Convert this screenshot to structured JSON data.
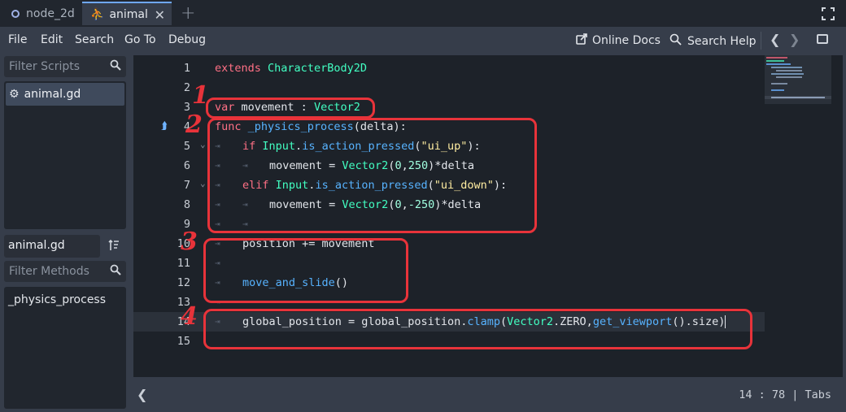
{
  "tabs": [
    {
      "label": "node_2d"
    },
    {
      "label": "animal"
    }
  ],
  "menu": {
    "items": [
      "File",
      "Edit",
      "Search",
      "Go To",
      "Debug"
    ],
    "online_docs": "Online Docs",
    "search_help": "Search Help"
  },
  "scripts_panel": {
    "filter_placeholder": "Filter Scripts",
    "items": [
      "animal.gd"
    ],
    "current_name": "animal.gd"
  },
  "methods_panel": {
    "filter_placeholder": "Filter Methods",
    "items": [
      "_physics_process"
    ]
  },
  "editor": {
    "current_line": 14,
    "lines": [
      {
        "n": "1",
        "code": "extends CharacterBody2D"
      },
      {
        "n": "2",
        "code": ""
      },
      {
        "n": "3",
        "code": "var movement : Vector2"
      },
      {
        "n": "4",
        "code": "func _physics_process(delta):"
      },
      {
        "n": "5",
        "code": "if Input.is_action_pressed(\"ui_up\"):"
      },
      {
        "n": "6",
        "code": "movement = Vector2(0,250)*delta"
      },
      {
        "n": "7",
        "code": "elif Input.is_action_pressed(\"ui_down\"):"
      },
      {
        "n": "8",
        "code": "movement = Vector2(0,-250)*delta"
      },
      {
        "n": "9",
        "code": ""
      },
      {
        "n": "10",
        "code": "position += movement"
      },
      {
        "n": "11",
        "code": ""
      },
      {
        "n": "12",
        "code": "move_and_slide()"
      },
      {
        "n": "13",
        "code": ""
      },
      {
        "n": "14",
        "code": "global_position = global_position.clamp(Vector2.ZERO,get_viewport().size)"
      },
      {
        "n": "15",
        "code": ""
      }
    ]
  },
  "annotations": [
    "1",
    "2",
    "3",
    "4"
  ],
  "status": {
    "line": "14",
    "col": "78",
    "indent": "Tabs",
    "text": "14 :  78 | Tabs"
  },
  "colors": {
    "keyword": "#ff7085",
    "class": "#42ffc2",
    "function": "#57b3ff",
    "string": "#ffeda1",
    "annotation": "#e8333a"
  }
}
